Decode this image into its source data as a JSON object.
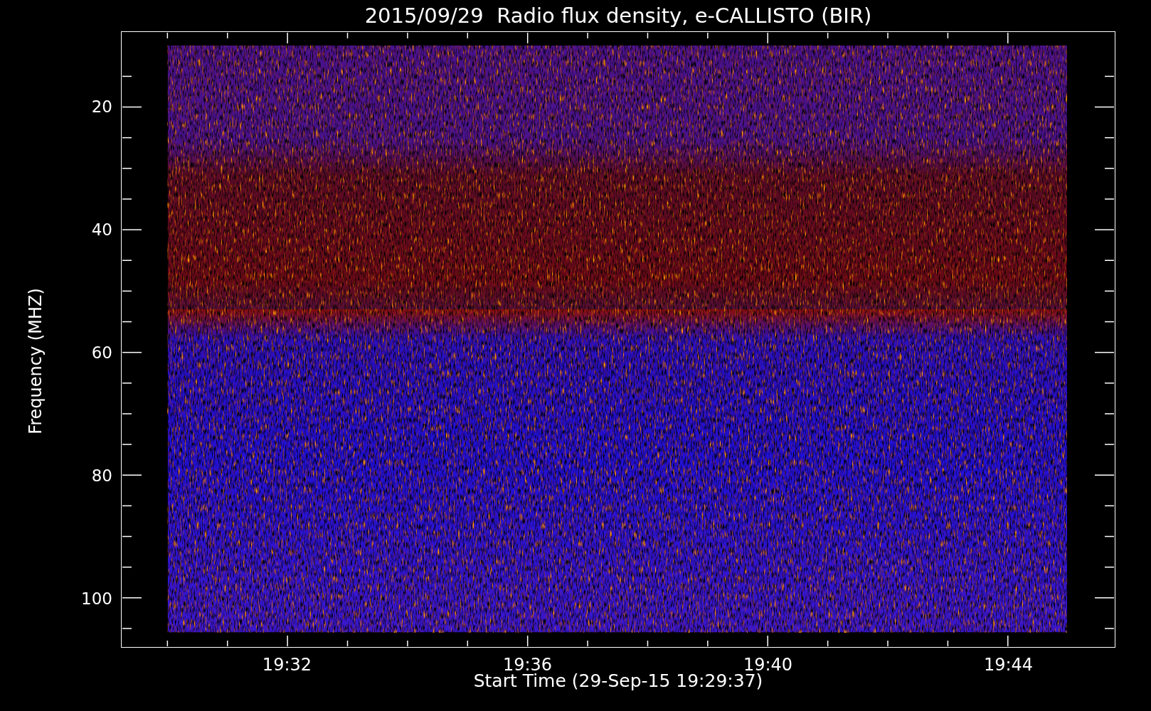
{
  "title": "2015/09/29  Radio flux density, e-CALLISTO (BIR)",
  "y_axis": {
    "label": "Frequency (MHZ)",
    "ticks": [
      "20",
      "40",
      "60",
      "80",
      "100"
    ]
  },
  "x_axis": {
    "label": "Start Time (29-Sep-15 19:29:37)",
    "ticks": [
      "19:32",
      "19:36",
      "19:40",
      "19:44"
    ]
  }
}
